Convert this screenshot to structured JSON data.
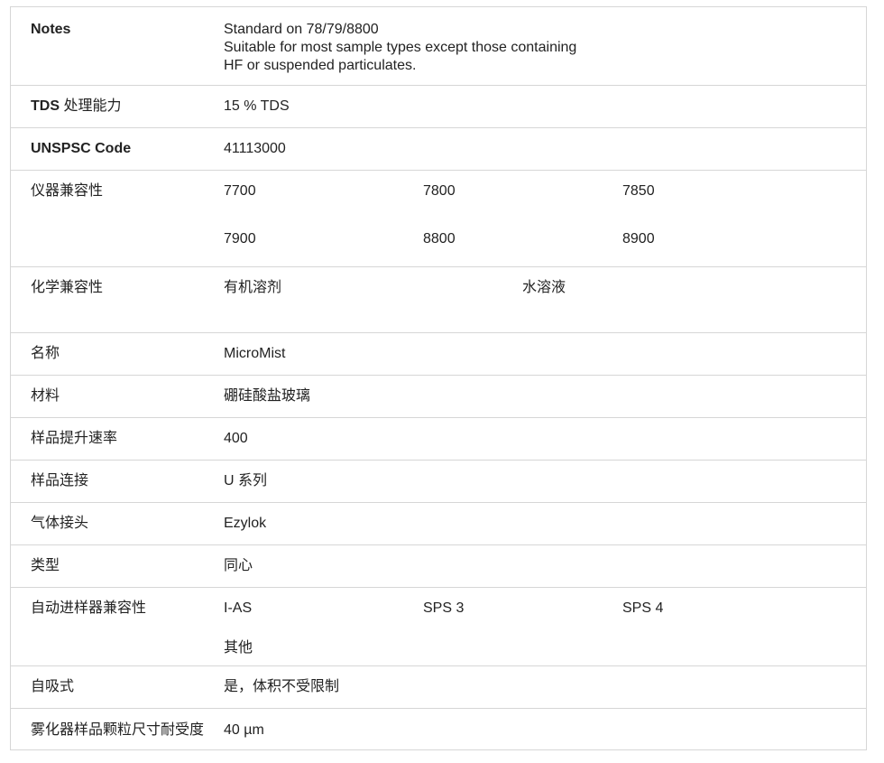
{
  "rows": {
    "notes": {
      "label": "Notes",
      "lines": [
        "Standard on 78/79/8800",
        "Suitable for most sample types except those containing",
        "HF or suspended particulates."
      ]
    },
    "tds": {
      "label_bold": "TDS",
      "label_rest": " 处理能力",
      "value": "15 % TDS"
    },
    "unspsc": {
      "label": "UNSPSC Code",
      "value": "41113000"
    },
    "instrument": {
      "label": "仪器兼容性",
      "items": [
        "7700",
        "7800",
        "7850",
        "7900",
        "8800",
        "8900"
      ]
    },
    "chemical": {
      "label": "化学兼容性",
      "items": [
        "有机溶剂",
        "水溶液"
      ]
    },
    "name": {
      "label": "名称",
      "value": "MicroMist"
    },
    "material": {
      "label": "材料",
      "value": "硼硅酸盐玻璃"
    },
    "uptake": {
      "label": "样品提升速率",
      "value": "400"
    },
    "connection": {
      "label": "样品连接",
      "value": "U 系列"
    },
    "gas": {
      "label": "气体接头",
      "value": "Ezylok"
    },
    "type": {
      "label": "类型",
      "value": "同心"
    },
    "autosampler": {
      "label": "自动进样器兼容性",
      "items": [
        "I-AS",
        "SPS 3",
        "SPS 4",
        "其他"
      ]
    },
    "selfaspirating": {
      "label": "自吸式",
      "value": "是，体积不受限制"
    },
    "tolerance": {
      "label": "雾化器样品颗粒尺寸耐受度",
      "value": "40 µm"
    }
  }
}
